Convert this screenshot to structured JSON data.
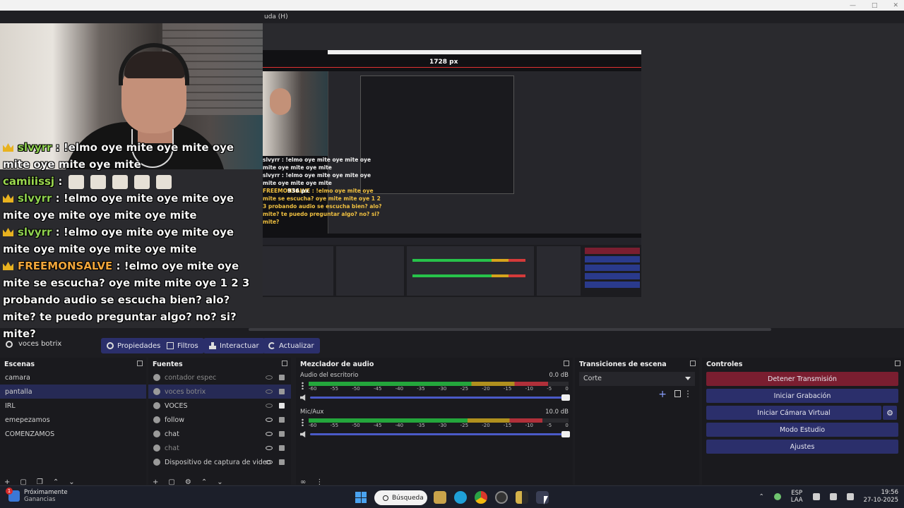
{
  "menu": {
    "help_partial": "uda (H)"
  },
  "chat": [
    {
      "user": "slvyrr",
      "message": ": !elmo oye mite oye mite oye mite oye mite oye mite",
      "badge": true,
      "cut_top": true
    },
    {
      "user": "camiiissj",
      "message": ":",
      "badge": false,
      "emotes": 5
    },
    {
      "user": "slvyrr",
      "message": ": !elmo oye mite oye mite oye mite oye mite oye mite oye mite",
      "badge": true
    },
    {
      "user": "slvyrr",
      "message": ": !elmo oye mite oye mite oye mite oye mite oye mite oye mite",
      "badge": true
    },
    {
      "user": "FREEMONSALVE",
      "message": ": !elmo oye mite oye mite se escucha? oye mite mite oye 1 2 3 probando audio se escucha bien? alo? mite? te puedo preguntar algo? no? si? mite?",
      "badge": true
    }
  ],
  "nested": {
    "width_label": "1728 px",
    "height_label": "936 px",
    "chat_lines": [
      "slvyrr : !elmo oye mite oye mite oye mite oye mite oye mite",
      "slvyrr : !elmo oye mite oye mite oye mite oye mite oye mite",
      "FREEMONSALVE : !elmo oye mite oye mite se escucha? oye mite mite oye 1 2 3 probando audio se escucha bien? alo? mite? te puedo preguntar algo? no? si? mite?"
    ]
  },
  "source_bar": {
    "current_source": "voces botrix",
    "buttons": [
      "Propiedades",
      "Filtros",
      "Interactuar",
      "Actualizar"
    ]
  },
  "scenes": {
    "title": "Escenas",
    "items": [
      "camara",
      "pantalla",
      "IRL",
      "emepezamos",
      "COMENZAMOS"
    ],
    "selected_index": 1
  },
  "sources": {
    "title": "Fuentes",
    "items": [
      {
        "name": "contador espec",
        "visible": false,
        "dim": true
      },
      {
        "name": "voces botrix",
        "visible": false,
        "dim": true,
        "selected": true
      },
      {
        "name": "VOCES",
        "visible": false,
        "dim": false
      },
      {
        "name": "follow",
        "visible": true,
        "dim": false
      },
      {
        "name": "chat",
        "visible": true,
        "dim": false
      },
      {
        "name": "chat",
        "visible": true,
        "dim": true
      },
      {
        "name": "Dispositivo de captura de video",
        "visible": true,
        "dim": false
      }
    ]
  },
  "mixer": {
    "title": "Mezclador de audio",
    "ticks": [
      "-60",
      "-55",
      "-50",
      "-45",
      "-40",
      "-35",
      "-30",
      "-25",
      "-20",
      "-15",
      "-10",
      "-5",
      "0"
    ],
    "channels": [
      {
        "name": "Audio del escritorio",
        "db": "0.0 dB",
        "level": 0.92,
        "volume": 1.0
      },
      {
        "name": "Mic/Aux",
        "db": "10.0 dB",
        "level": 0.9,
        "volume": 1.0
      }
    ]
  },
  "transitions": {
    "title": "Transiciones de escena",
    "selected": "Corte"
  },
  "controls": {
    "title": "Controles",
    "buttons": [
      "Detener Transmisión",
      "Iniciar Grabación",
      "Iniciar Cámara Virtual",
      "Modo Estudio",
      "Ajustes"
    ]
  },
  "taskbar": {
    "widget_title": "Próximamente",
    "widget_subtitle": "Ganancias",
    "widget_badge": "1",
    "search_label": "Búsqueda",
    "lang_top": "ESP",
    "lang_bottom": "LAA",
    "time": "19:56",
    "date": "27-10-2025"
  },
  "colors": {
    "accent_blue": "#2b2f6b",
    "stop_red": "#7a1e30",
    "meter_green": "#24a63c",
    "meter_yellow": "#b0901e",
    "meter_red": "#b0303a"
  }
}
